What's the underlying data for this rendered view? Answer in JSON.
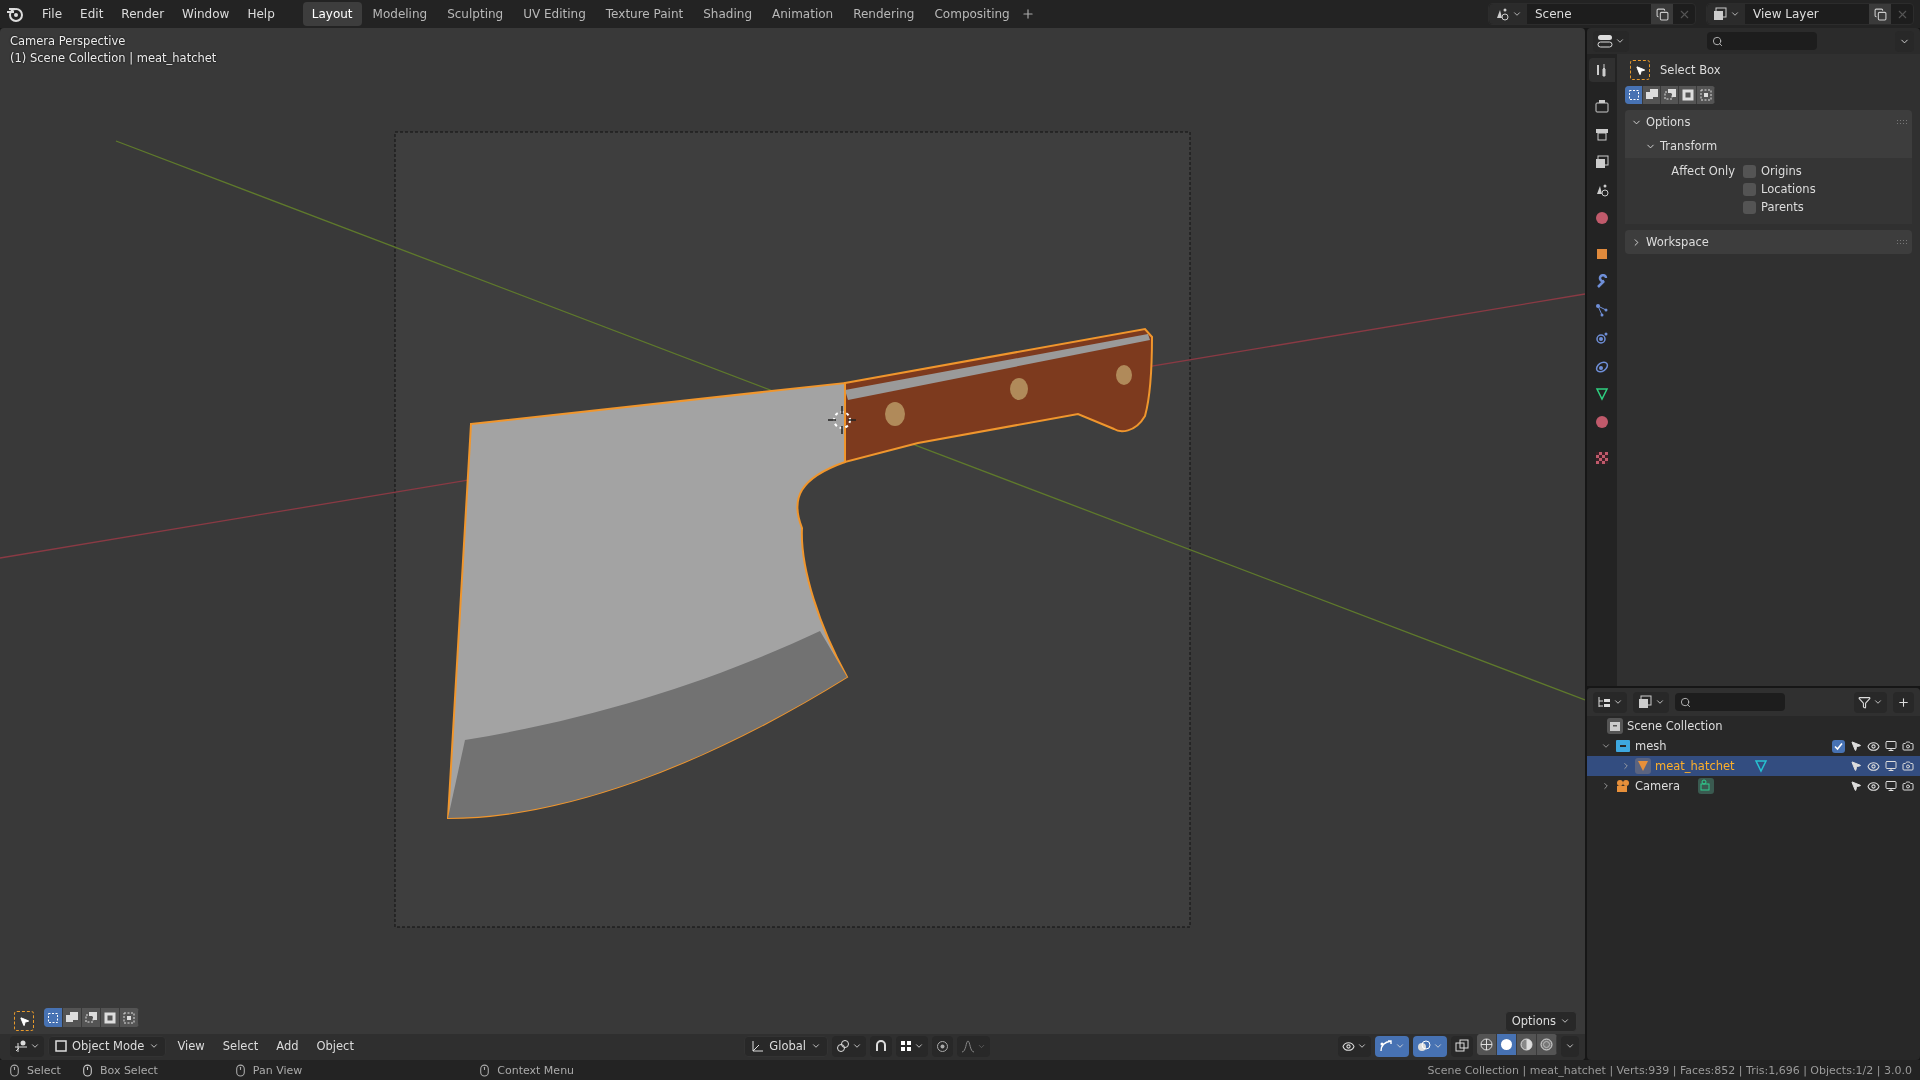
{
  "menu": [
    "File",
    "Edit",
    "Render",
    "Window",
    "Help"
  ],
  "workspaces": [
    {
      "label": "Layout",
      "selected": true
    },
    {
      "label": "Modeling",
      "selected": false
    },
    {
      "label": "Sculpting",
      "selected": false
    },
    {
      "label": "UV Editing",
      "selected": false
    },
    {
      "label": "Texture Paint",
      "selected": false
    },
    {
      "label": "Shading",
      "selected": false
    },
    {
      "label": "Animation",
      "selected": false
    },
    {
      "label": "Rendering",
      "selected": false
    },
    {
      "label": "Compositing",
      "selected": false
    }
  ],
  "scene": "Scene",
  "view_layer": "View Layer",
  "viewport": {
    "overlay_lines": [
      "Camera Perspective",
      "(1) Scene Collection | meat_hatchet"
    ],
    "select_modes": [
      {
        "kind": "set",
        "selected": true
      },
      {
        "kind": "extend",
        "selected": false
      },
      {
        "kind": "subtract",
        "selected": false
      },
      {
        "kind": "invert",
        "selected": false
      },
      {
        "kind": "intersect",
        "selected": false
      }
    ],
    "options": "Options",
    "mode": "Object Mode",
    "menus": [
      "View",
      "Select",
      "Add",
      "Object"
    ],
    "orientation": "Global",
    "snap": {
      "on": false
    },
    "toggles": [
      {
        "kind": "visibility",
        "on": false
      },
      {
        "kind": "gizmo",
        "on": true
      },
      {
        "kind": "overlay",
        "on": true
      },
      {
        "kind": "xray",
        "on": false
      }
    ],
    "shading": [
      {
        "kind": "wireframe",
        "selected": false
      },
      {
        "kind": "solid",
        "selected": true
      },
      {
        "kind": "material",
        "selected": false
      },
      {
        "kind": "rendered",
        "selected": false
      }
    ]
  },
  "properties": {
    "tabs": [
      {
        "kind": "tool",
        "selected": true
      },
      {
        "kind": "render",
        "selected": false
      },
      {
        "kind": "output",
        "selected": false
      },
      {
        "kind": "view_layer",
        "selected": false
      },
      {
        "kind": "scene",
        "selected": false
      },
      {
        "kind": "world",
        "selected": false
      },
      {
        "kind": "object",
        "selected": false
      },
      {
        "kind": "modifier",
        "selected": false
      },
      {
        "kind": "particles",
        "selected": false
      },
      {
        "kind": "physics",
        "selected": false
      },
      {
        "kind": "constraint",
        "selected": false
      },
      {
        "kind": "data",
        "selected": false
      },
      {
        "kind": "material",
        "selected": false
      },
      {
        "kind": "texture",
        "selected": false
      }
    ],
    "tool_name": "Select Box",
    "select_modes": [
      {
        "kind": "set",
        "selected": true
      },
      {
        "kind": "extend",
        "selected": false
      },
      {
        "kind": "subtract",
        "selected": false
      },
      {
        "kind": "invert",
        "selected": false
      },
      {
        "kind": "intersect",
        "selected": false
      }
    ],
    "panels": [
      {
        "title": "Options",
        "expanded": true,
        "subpanels": [
          {
            "title": "Transform",
            "expanded": true,
            "label": "Affect Only",
            "checkboxes": [
              {
                "label": "Origins",
                "checked": false
              },
              {
                "label": "Locations",
                "checked": false
              },
              {
                "label": "Parents",
                "checked": false
              }
            ]
          }
        ]
      },
      {
        "title": "Workspace",
        "expanded": false
      }
    ]
  },
  "outliner": {
    "root": "Scene Collection",
    "items": [
      {
        "name": "mesh",
        "kind": "collection",
        "expanded": true,
        "checked": true,
        "selected": false,
        "children": [
          {
            "name": "meat_hatchet",
            "kind": "mesh",
            "expanded": false,
            "selected": true
          }
        ]
      },
      {
        "name": "Camera",
        "kind": "camera",
        "expanded": false,
        "selected": false
      }
    ]
  },
  "status": {
    "hints": [
      {
        "kind": "left",
        "label": "Select"
      },
      {
        "kind": "drag",
        "label": "Box Select"
      },
      {
        "kind": "middle",
        "label": "Pan View"
      },
      {
        "kind": "right",
        "label": "Context Menu"
      }
    ],
    "stats": "Scene Collection | meat_hatchet | Verts:939 | Faces:852 | Tris:1,696 | Objects:1/2 | 3.0.0"
  }
}
